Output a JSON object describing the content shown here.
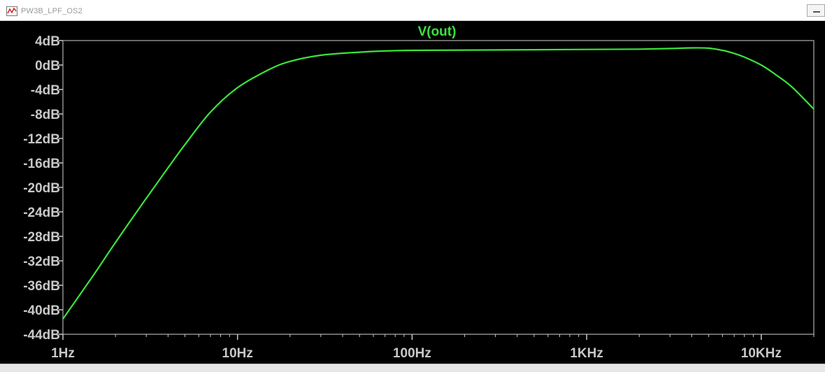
{
  "window": {
    "title": "PW3B_LPF_OS2",
    "app_icon": "waveform-viewer-icon",
    "minimize_icon": "minimize-icon"
  },
  "colors": {
    "background": "#000000",
    "trace": "#3be33b",
    "axis_label": "#c8c8c8",
    "plot_frame": "#8c8c8c",
    "tick": "#c8c8c8"
  },
  "chart_data": {
    "type": "line",
    "title": "V(out)",
    "x_scale": "log",
    "xlim": [
      1,
      20000
    ],
    "ylim": [
      -44,
      4
    ],
    "y_ticks": [
      4,
      0,
      -4,
      -8,
      -12,
      -16,
      -20,
      -24,
      -28,
      -32,
      -36,
      -40,
      -44
    ],
    "y_tick_labels": [
      "4dB",
      "0dB",
      "-4dB",
      "-8dB",
      "-12dB",
      "-16dB",
      "-20dB",
      "-24dB",
      "-28dB",
      "-32dB",
      "-36dB",
      "-40dB",
      "-44dB"
    ],
    "x_ticks": [
      1,
      10,
      100,
      1000,
      10000
    ],
    "x_tick_labels": [
      "1Hz",
      "10Hz",
      "100Hz",
      "1KHz",
      "10KHz"
    ],
    "grid": false,
    "series": [
      {
        "name": "V(out)",
        "x": [
          1,
          1.5,
          2,
          3,
          4,
          5,
          7,
          10,
          15,
          20,
          30,
          50,
          70,
          100,
          200,
          500,
          1000,
          2000,
          3000,
          4000,
          5000,
          6000,
          7000,
          8000,
          10000,
          12000,
          15000,
          20000
        ],
        "y": [
          -41.5,
          -34.3,
          -29.0,
          -21.8,
          -16.8,
          -13.0,
          -7.7,
          -3.7,
          -0.8,
          0.6,
          1.6,
          2.1,
          2.3,
          2.4,
          2.45,
          2.5,
          2.55,
          2.6,
          2.7,
          2.8,
          2.75,
          2.4,
          1.9,
          1.3,
          0.0,
          -1.5,
          -3.6,
          -7.2
        ]
      }
    ]
  }
}
